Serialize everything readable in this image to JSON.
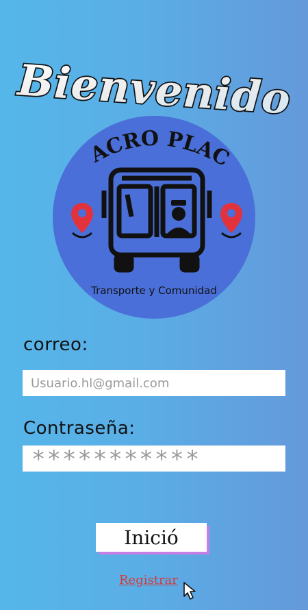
{
  "header": {
    "title": "Bienvenido"
  },
  "logo": {
    "brand": "MACRO PLACE",
    "tagline": "Transporte y Comunidad",
    "icons": [
      "location-pin-icon",
      "bus-icon",
      "driver-icon"
    ]
  },
  "form": {
    "email_label": "correo:",
    "email_placeholder": "Usuario.hl@gmail.com",
    "password_label": "Contraseña:",
    "password_mask": "***********",
    "submit_label": "Inició",
    "register_label": "Registrar"
  },
  "colors": {
    "accent_shadow": "#c77ee5",
    "register_link": "#d63a3a",
    "logo_circle": "#4a6fd8",
    "pin_red": "#e2333d"
  }
}
